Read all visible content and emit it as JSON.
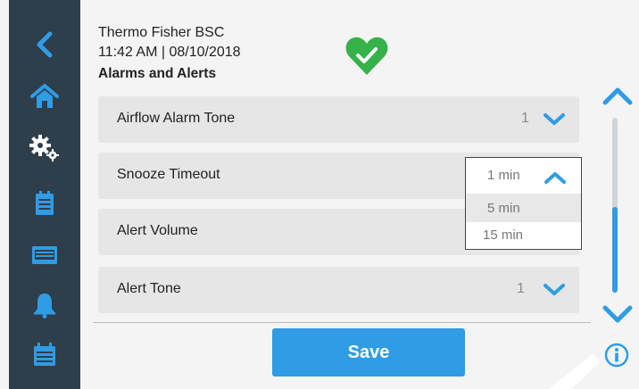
{
  "header": {
    "device_name": "Thermo Fisher BSC",
    "datetime": "11:42  AM | 08/10/2018",
    "page_title": "Alarms and Alerts"
  },
  "sidebar": {
    "items": [
      {
        "icon": "back-icon"
      },
      {
        "icon": "home-icon"
      },
      {
        "icon": "settings-icon",
        "active": true
      },
      {
        "icon": "clipboard-icon"
      },
      {
        "icon": "display-icon"
      },
      {
        "icon": "bell-icon"
      },
      {
        "icon": "calendar-icon"
      }
    ]
  },
  "settings": {
    "rows": [
      {
        "label": "Airflow Alarm Tone",
        "value": "1"
      },
      {
        "label": "Snooze Timeout",
        "value": "1 min"
      },
      {
        "label": "Alert Volume",
        "value": ""
      },
      {
        "label": "Alert Tone",
        "value": "1"
      }
    ],
    "dropdown": {
      "current": "1 min",
      "options": [
        "5 min",
        "15 min"
      ]
    }
  },
  "actions": {
    "save_label": "Save"
  },
  "colors": {
    "sidebar": "#2f3e4b",
    "accent": "#2f9ce5",
    "status_green": "#36b24a",
    "row_bg": "#e6e6e6"
  }
}
